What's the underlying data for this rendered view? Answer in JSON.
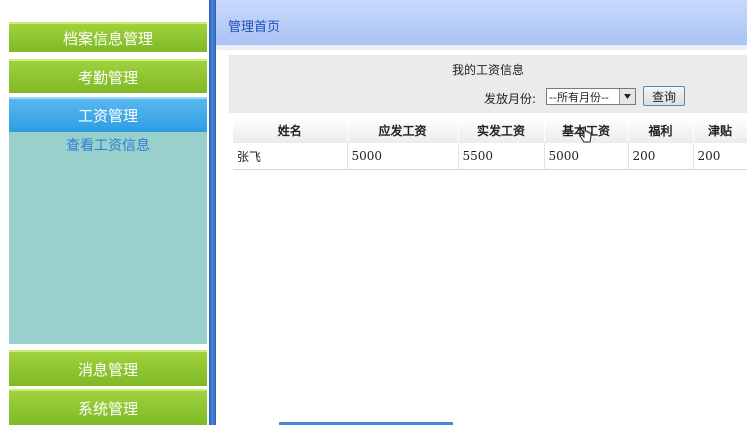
{
  "sidebar": {
    "items": [
      {
        "label": "档案信息管理"
      },
      {
        "label": "考勤管理"
      },
      {
        "label": "工资管理"
      },
      {
        "label": "消息管理"
      },
      {
        "label": "系统管理"
      }
    ],
    "submenu": [
      {
        "label": "查看工资信息"
      }
    ]
  },
  "header": {
    "breadcrumb": "管理首页"
  },
  "panel": {
    "title": "我的工资信息",
    "filter_label": "发放月份:",
    "month_select_value": "--所有月份--",
    "query_button": "查询"
  },
  "table": {
    "columns": [
      "姓名",
      "应发工资",
      "实发工资",
      "基本工资",
      "福利",
      "津贴"
    ],
    "rows": [
      [
        "张飞",
        "5000",
        "5500",
        "5000",
        "200",
        "200"
      ]
    ]
  },
  "colors": {
    "menu_green": "#8cc531",
    "menu_active": "#3aa7e8",
    "submenu_bg": "#99d0cb",
    "topbar": "#b8cdf8",
    "divider": "#3a73c9"
  },
  "icons": {
    "dropdown": "chevron-down-icon",
    "cursor": "mouse-pointer-icon"
  }
}
